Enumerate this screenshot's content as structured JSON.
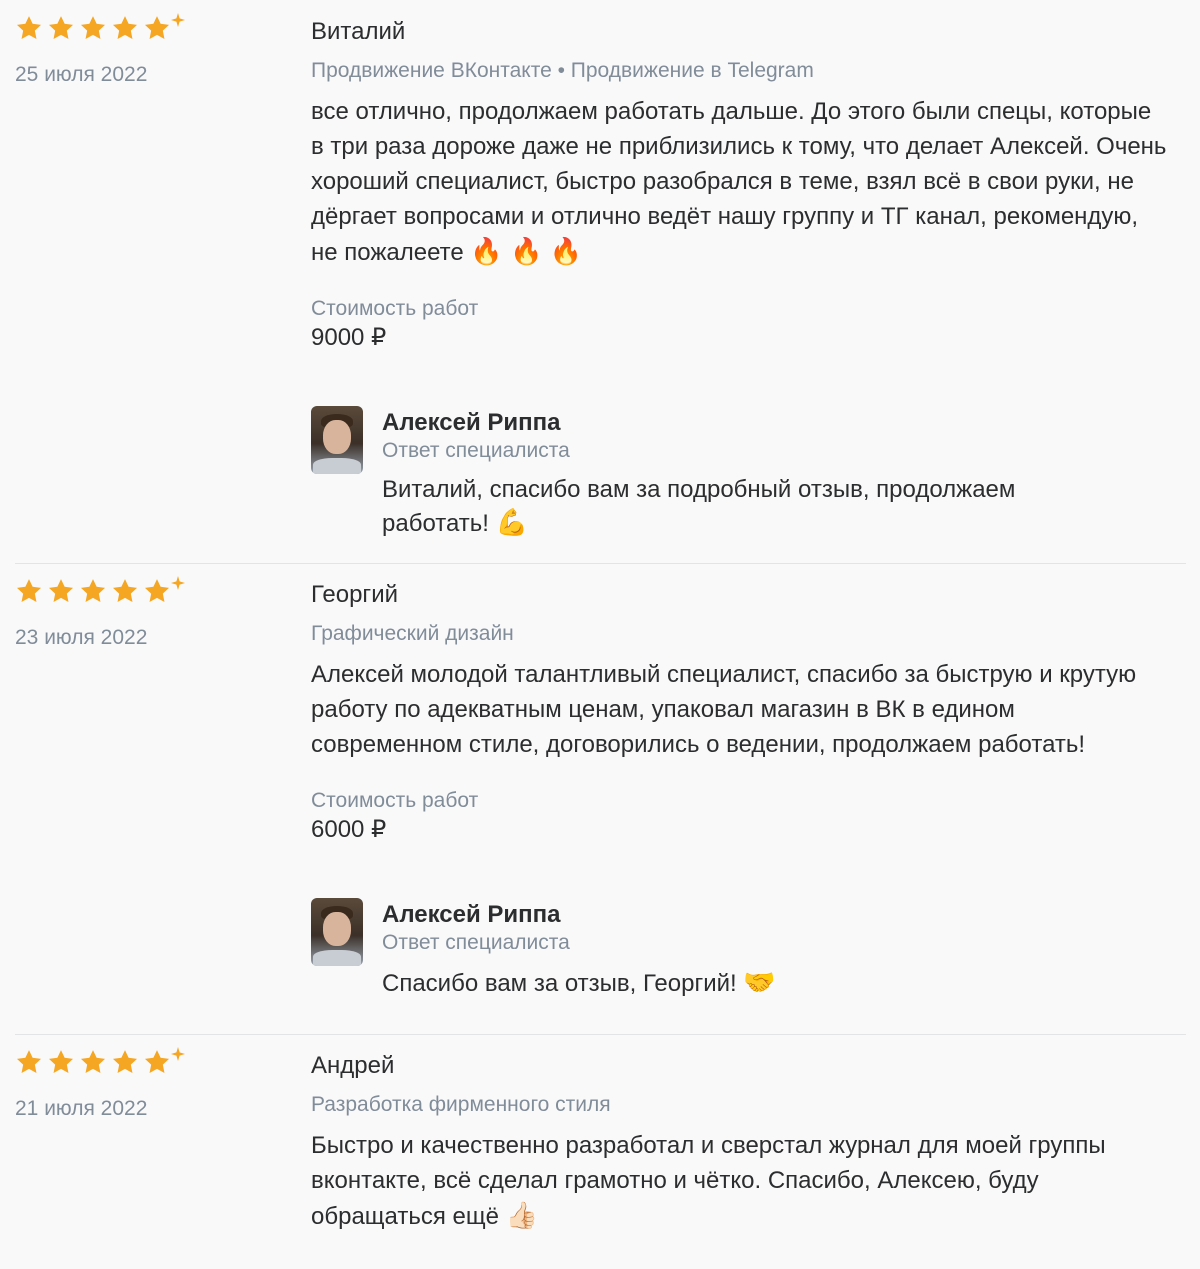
{
  "colors": {
    "star": "#f5a623",
    "muted": "#818c99",
    "text": "#2c2d2e"
  },
  "reviews": [
    {
      "rating": 5,
      "date": "25 июля 2022",
      "author": "Виталий",
      "tags": "Продвижение ВКонтакте • Продвижение в Telegram",
      "text": "все отлично, продолжаем работать дальше. До этого были спецы, которые в три раза дороже даже не приблизились к тому, что делает Алексей. Очень хороший специалист, быстро разобрался в теме, взял всё в свои руки, не дёргает вопросами и отлично ведёт нашу группу и ТГ канал, рекомендую, не пожалеете",
      "text_emoji": "🔥 🔥 🔥",
      "cost_label": "Стоимость работ",
      "cost_value": "9000 ₽",
      "reply": {
        "name": "Алексей Риппа",
        "role": "Ответ специалиста",
        "text": "Виталий, спасибо вам за подробный отзыв, продолжаем работать!",
        "emoji": "💪"
      }
    },
    {
      "rating": 5,
      "date": "23 июля 2022",
      "author": "Георгий",
      "tags": "Графический дизайн",
      "text": "Алексей молодой талантливый специалист, спасибо за быструю и крутую работу по адекватным ценам, упаковал магазин в ВК в едином современном стиле, договорились о ведении, продолжаем работать!",
      "text_emoji": "",
      "cost_label": "Стоимость работ",
      "cost_value": "6000 ₽",
      "reply": {
        "name": "Алексей Риппа",
        "role": "Ответ специалиста",
        "text": "Спасибо вам за отзыв, Георгий!",
        "emoji": "🤝"
      }
    },
    {
      "rating": 5,
      "date": "21 июля 2022",
      "author": "Андрей",
      "tags": "Разработка фирменного стиля",
      "text": "Быстро и качественно разработал и сверстал журнал для моей группы вконтакте, всё сделал грамотно и чётко. Спасибо, Алексею, буду обращаться ещё",
      "text_emoji": "👍🏻"
    }
  ]
}
